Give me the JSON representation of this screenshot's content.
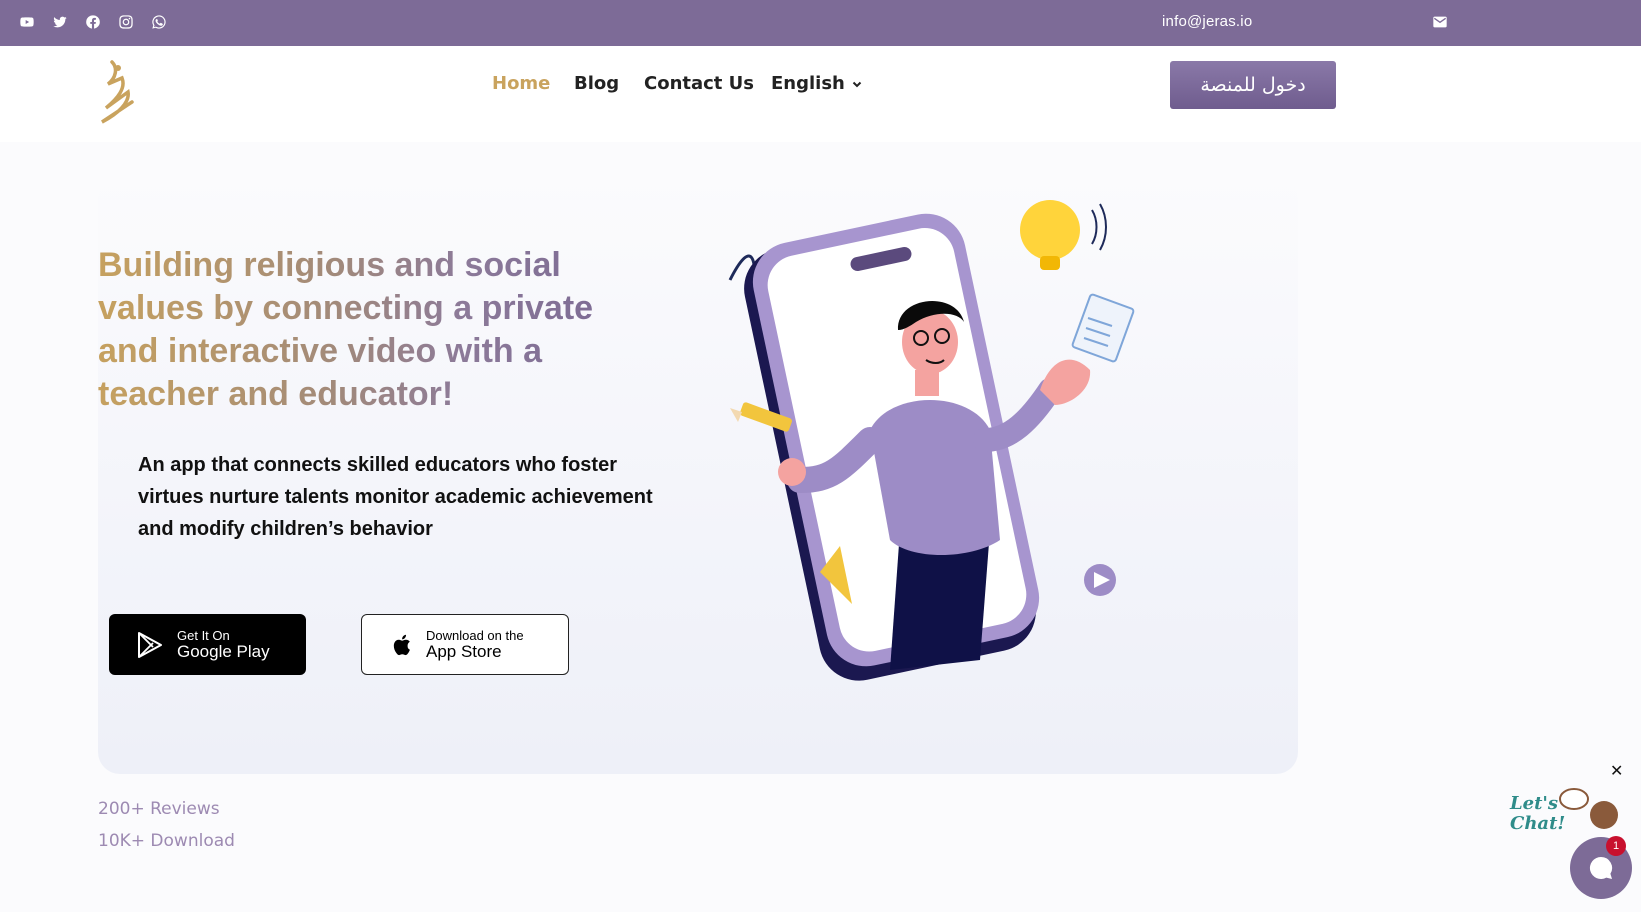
{
  "topbar": {
    "social_icons": [
      "youtube-icon",
      "twitter-icon",
      "facebook-icon",
      "instagram-icon",
      "whatsapp-icon"
    ],
    "email": "info@jeras.io",
    "mail_icon": "mail-icon",
    "background": "#7d6b97"
  },
  "header": {
    "nav": {
      "home": "Home",
      "blog": "Blog",
      "contact": "Contact Us",
      "language": "English"
    },
    "login_label": "دخول للمنصة",
    "accent": "#c9a35e"
  },
  "hero": {
    "title": "Building religious and social values by connecting a private and interactive video with a teacher and educator!",
    "subtitle": "An app that connects skilled educators who foster virtues nurture talents monitor academic achievement and modify children’s behavior",
    "google_play": {
      "small": "Get It On",
      "big": "Google Play"
    },
    "app_store": {
      "small": "Download on the",
      "big": "App Store"
    }
  },
  "stats": {
    "reviews": "200+ Reviews",
    "downloads": "10K+ Download"
  },
  "chat": {
    "close": "✕",
    "badge": "1",
    "lets_chat": "Let's Chat!"
  }
}
